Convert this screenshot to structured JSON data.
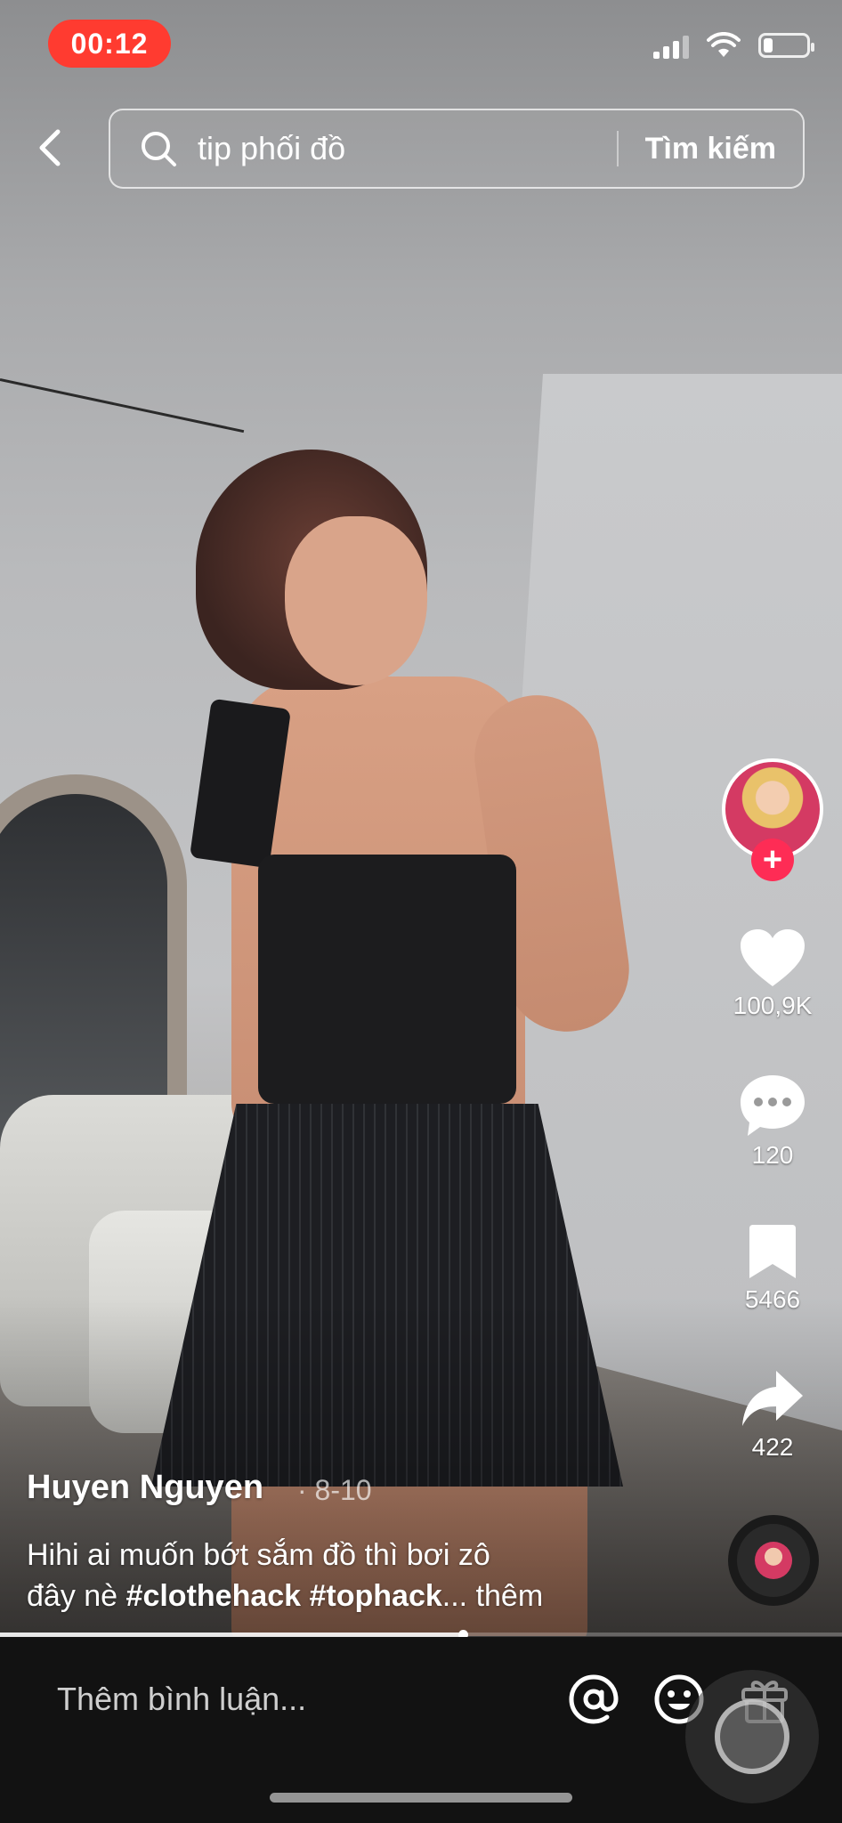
{
  "status_bar": {
    "time": "00:12"
  },
  "search": {
    "query": "tip phối đồ",
    "submit_label": "Tìm kiếm"
  },
  "rail": {
    "likes": "100,9K",
    "comments": "120",
    "saves": "5466",
    "shares": "422"
  },
  "post": {
    "author": "Huyen Nguyen",
    "date": "· 8-10",
    "caption_line1": "Hihi ai muốn bớt sắm đồ thì bơi zô",
    "caption_prefix": "đây nè ",
    "hashtag1": "#clothehack",
    "hashtag2": "#tophack",
    "more_label": "... thêm",
    "progress": 0.55
  },
  "comment_bar": {
    "placeholder": "Thêm bình luận..."
  },
  "colors": {
    "time_pill": "#ff3b30",
    "follow_accent": "#fe2c55",
    "bottom_bar": "#121212"
  },
  "icons": [
    "back-arrow-icon",
    "search-icon",
    "heart-icon",
    "comment-bubble-icon",
    "bookmark-icon",
    "share-arrow-icon",
    "mention-icon",
    "emoji-icon",
    "gift-icon",
    "plus-icon"
  ]
}
